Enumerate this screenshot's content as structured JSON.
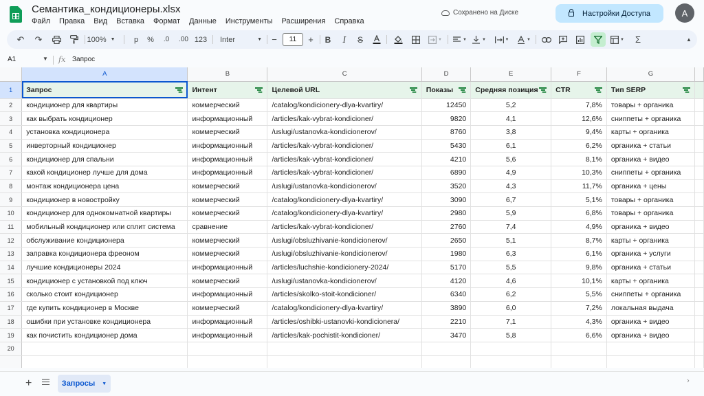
{
  "app": {
    "title": "Семантика_кондиционеры.xlsx",
    "menu": [
      "Файл",
      "Правка",
      "Вид",
      "Вставка",
      "Формат",
      "Данные",
      "Инструменты",
      "Расширения",
      "Справка"
    ],
    "saved_status": "Сохранено на Диске",
    "share_label": "Настройки Доступа",
    "avatar_letter": "A"
  },
  "toolbar": {
    "zoom": "100%",
    "currency": "р",
    "percent": "%",
    "decimal_decrease": ".0",
    "decimal_increase": ".00",
    "number_format": "123",
    "font": "Inter",
    "font_size": "11",
    "minus": "−",
    "plus": "+",
    "sum": "Σ"
  },
  "formula_bar": {
    "cell_ref": "A1",
    "fx": "fx",
    "value": "Запрос"
  },
  "grid": {
    "column_letters": [
      "A",
      "B",
      "C",
      "D",
      "E",
      "F",
      "G"
    ],
    "header_row": [
      "Запрос",
      "Интент",
      "Целевой URL",
      "Показы",
      "Средняя позиция",
      "CTR",
      "Тип SERP"
    ],
    "rows": [
      [
        "кондиционер для квартиры",
        "коммерческий",
        "/catalog/kondicionery-dlya-kvartiry/",
        "12450",
        "5,2",
        "7,8%",
        "товары + органика"
      ],
      [
        "как выбрать кондиционер",
        "информационный",
        "/articles/kak-vybrat-kondicioner/",
        "9820",
        "4,1",
        "12,6%",
        "сниппеты + органика"
      ],
      [
        "установка кондиционера",
        "коммерческий",
        "/uslugi/ustanovka-kondicionerov/",
        "8760",
        "3,8",
        "9,4%",
        "карты + органика"
      ],
      [
        "инверторный кондиционер",
        "информационный",
        "/articles/kak-vybrat-kondicioner/",
        "5430",
        "6,1",
        "6,2%",
        "органика + статьи"
      ],
      [
        "кондиционер для спальни",
        "информационный",
        "/articles/kak-vybrat-kondicioner/",
        "4210",
        "5,6",
        "8,1%",
        "органика + видео"
      ],
      [
        "какой кондиционер лучше для дома",
        "информационный",
        "/articles/kak-vybrat-kondicioner/",
        "6890",
        "4,9",
        "10,3%",
        "сниппеты + органика"
      ],
      [
        "монтаж кондиционера цена",
        "коммерческий",
        "/uslugi/ustanovka-kondicionerov/",
        "3520",
        "4,3",
        "11,7%",
        "органика + цены"
      ],
      [
        "кондиционер в новостройку",
        "коммерческий",
        "/catalog/kondicionery-dlya-kvartiry/",
        "3090",
        "6,7",
        "5,1%",
        "товары + органика"
      ],
      [
        "кондиционер для однокомнатной квартиры",
        "коммерческий",
        "/catalog/kondicionery-dlya-kvartiry/",
        "2980",
        "5,9",
        "6,8%",
        "товары + органика"
      ],
      [
        "мобильный кондиционер или сплит система",
        "сравнение",
        "/articles/kak-vybrat-kondicioner/",
        "2760",
        "7,4",
        "4,9%",
        "органика + видео"
      ],
      [
        "обслуживание кондиционера",
        "коммерческий",
        "/uslugi/obsluzhivanie-kondicionerov/",
        "2650",
        "5,1",
        "8,7%",
        "карты + органика"
      ],
      [
        "заправка кондиционера фреоном",
        "коммерческий",
        "/uslugi/obsluzhivanie-kondicionerov/",
        "1980",
        "6,3",
        "6,1%",
        "органика + услуги"
      ],
      [
        "лучшие кондиционеры 2024",
        "информационный",
        "/articles/luchshie-kondicionery-2024/",
        "5170",
        "5,5",
        "9,8%",
        "органика + статьи"
      ],
      [
        "кондиционер с установкой под ключ",
        "коммерческий",
        "/uslugi/ustanovka-kondicionerov/",
        "4120",
        "4,6",
        "10,1%",
        "карты + органика"
      ],
      [
        "сколько стоит кондиционер",
        "информационный",
        "/articles/skolko-stoit-kondicioner/",
        "6340",
        "6,2",
        "5,5%",
        "сниппеты + органика"
      ],
      [
        "где купить кондиционер в Москве",
        "коммерческий",
        "/catalog/kondicionery-dlya-kvartiry/",
        "3890",
        "6,0",
        "7,2%",
        "локальная выдача"
      ],
      [
        "ошибки при установке кондиционера",
        "информационный",
        "/articles/oshibki-ustanovki-kondicionera/",
        "2210",
        "7,1",
        "4,3%",
        "органика + видео"
      ],
      [
        "как почистить кондиционер дома",
        "информационный",
        "/articles/kak-pochistit-kondicioner/",
        "3470",
        "5,8",
        "6,6%",
        "органика + видео"
      ]
    ],
    "empty_row_number": "20"
  },
  "sheets": {
    "add": "+",
    "active_tab": "Запросы"
  }
}
